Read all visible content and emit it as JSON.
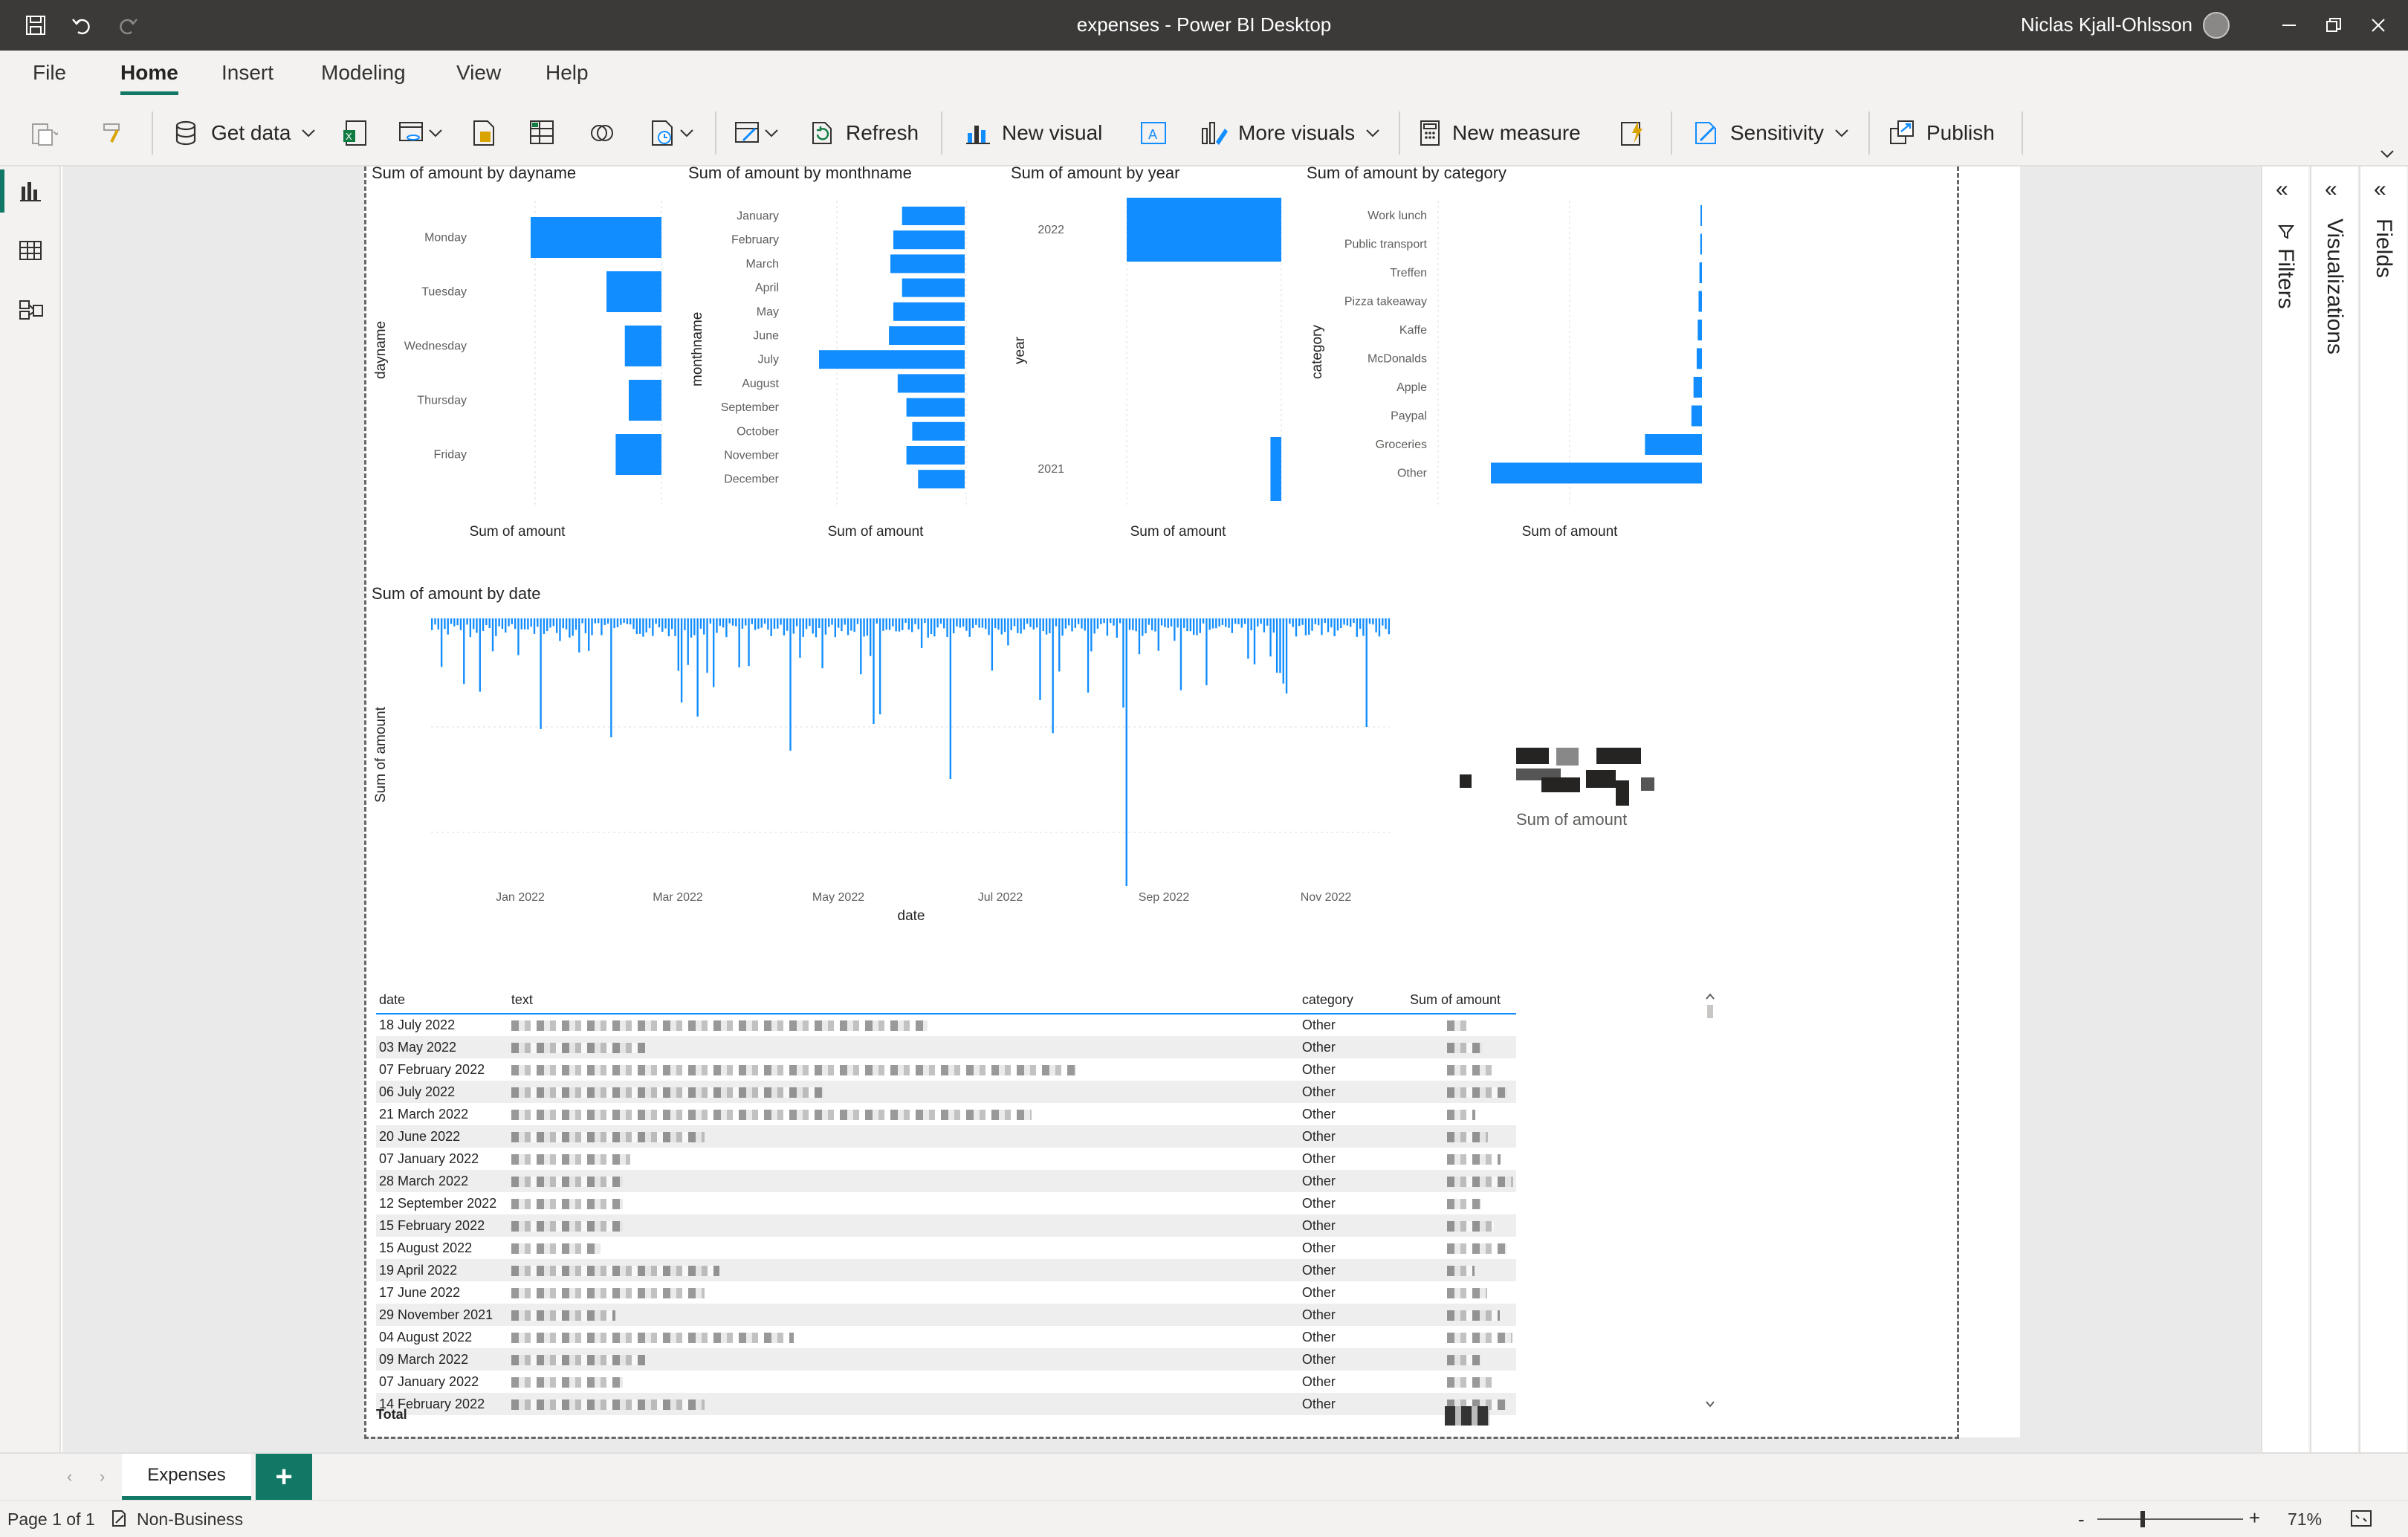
{
  "app": {
    "title": "expenses - Power BI Desktop",
    "user": "Niclas Kjall-Ohlsson"
  },
  "menu_tabs": [
    "File",
    "Home",
    "Insert",
    "Modeling",
    "View",
    "Help"
  ],
  "ribbon": {
    "get_data": "Get data",
    "refresh": "Refresh",
    "new_visual": "New visual",
    "more_visuals": "More visuals",
    "new_measure": "New measure",
    "sensitivity": "Sensitivity",
    "publish": "Publish"
  },
  "panes": {
    "filters": "Filters",
    "visualizations": "Visualizations",
    "fields": "Fields"
  },
  "visuals": {
    "dayname": {
      "title": "Sum of amount by dayname",
      "ylabel": "dayname",
      "xlabel": "Sum of amount",
      "categories": [
        "Monday",
        "Tuesday",
        "Wednesday",
        "Thursday",
        "Friday"
      ],
      "values": [
        1.0,
        0.42,
        0.28,
        0.25,
        0.35
      ]
    },
    "monthname": {
      "title": "Sum of amount by monthname",
      "ylabel": "monthname",
      "xlabel": "Sum of amount",
      "categories": [
        "January",
        "February",
        "March",
        "April",
        "May",
        "June",
        "July",
        "August",
        "September",
        "October",
        "November",
        "December"
      ],
      "values": [
        0.43,
        0.49,
        0.51,
        0.43,
        0.49,
        0.52,
        1.0,
        0.46,
        0.4,
        0.36,
        0.4,
        0.32
      ]
    },
    "year": {
      "title": "Sum of amount by year",
      "ylabel": "year",
      "xlabel": "Sum of amount",
      "categories": [
        "2022",
        "2021"
      ],
      "values": [
        1.0,
        0.07
      ]
    },
    "category": {
      "title": "Sum of amount by category",
      "ylabel": "category",
      "xlabel": "Sum of amount",
      "categories": [
        "Work lunch",
        "Public transport",
        "Treffen",
        "Pizza takeaway",
        "Kaffe",
        "McDonalds",
        "Apple",
        "Paypal",
        "Groceries",
        "Other"
      ],
      "values": [
        0.005,
        0.008,
        0.012,
        0.016,
        0.02,
        0.025,
        0.04,
        0.05,
        0.27,
        1.0
      ]
    },
    "date": {
      "title": "Sum of amount by date",
      "ylabel": "Sum of amount",
      "xlabel": "date",
      "ticks": [
        "Jan 2022",
        "Mar 2022",
        "May 2022",
        "Jul 2022",
        "Sep 2022",
        "Nov 2022"
      ]
    },
    "card": {
      "label": "Sum of amount"
    }
  },
  "table": {
    "headers": {
      "date": "date",
      "text": "text",
      "category": "category",
      "sum": "Sum of amount"
    },
    "rows": [
      {
        "date": "18 July 2022",
        "category": "Other"
      },
      {
        "date": "03 May 2022",
        "category": "Other"
      },
      {
        "date": "07 February 2022",
        "category": "Other"
      },
      {
        "date": "06 July 2022",
        "category": "Other"
      },
      {
        "date": "21 March 2022",
        "category": "Other"
      },
      {
        "date": "20 June 2022",
        "category": "Other"
      },
      {
        "date": "07 January 2022",
        "category": "Other"
      },
      {
        "date": "28 March 2022",
        "category": "Other"
      },
      {
        "date": "12 September 2022",
        "category": "Other"
      },
      {
        "date": "15 February 2022",
        "category": "Other"
      },
      {
        "date": "15 August 2022",
        "category": "Other"
      },
      {
        "date": "19 April 2022",
        "category": "Other"
      },
      {
        "date": "17 June 2022",
        "category": "Other"
      },
      {
        "date": "29 November 2021",
        "category": "Other"
      },
      {
        "date": "04 August 2022",
        "category": "Other"
      },
      {
        "date": "09 March 2022",
        "category": "Other"
      },
      {
        "date": "07 January 2022",
        "category": "Other"
      },
      {
        "date": "14 February 2022",
        "category": "Other"
      }
    ],
    "total_label": "Total"
  },
  "pages": {
    "tab": "Expenses",
    "add": "+"
  },
  "status": {
    "page": "Page 1 of 1",
    "sensitivity": "Non-Business",
    "zoom": "71%"
  },
  "colors": {
    "bar": "#118dff",
    "accent": "#117865",
    "titlebar": "#3b3a39"
  }
}
